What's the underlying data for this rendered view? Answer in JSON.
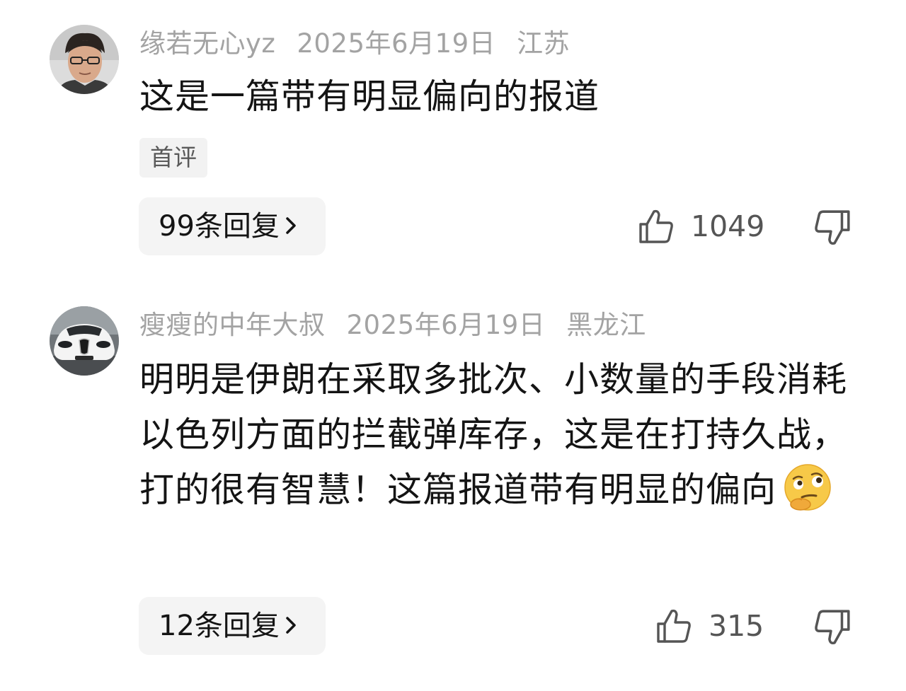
{
  "comments": [
    {
      "username": "缘若无心yz",
      "date": "2025年6月19日",
      "location": "江苏",
      "avatar": "person-avatar-icon",
      "text": "这是一篇带有明显偏向的报道",
      "tag": "首评",
      "replies_label": "99条回复",
      "likes": "1049"
    },
    {
      "username": "瘦瘦的中年大叔",
      "date": "2025年6月19日",
      "location": "黑龙江",
      "avatar": "white-sports-car-avatar-icon",
      "text": "明明是伊朗在采取多批次、小数量的手段消耗以色列方面的拦截弹库存，这是在打持久战，打的很有智慧！这篇报道带有明显的偏向",
      "emoji": "thinking-face-emoji-icon",
      "replies_label": "12条回复",
      "likes": "315"
    }
  ],
  "colors": {
    "meta_text": "#a3a3a3",
    "body_text": "#141414",
    "button_bg": "#f4f4f4",
    "icon_stroke": "#555555"
  },
  "icons": [
    "thumbs-up-icon",
    "thumbs-down-icon",
    "chevron-right-icon"
  ]
}
